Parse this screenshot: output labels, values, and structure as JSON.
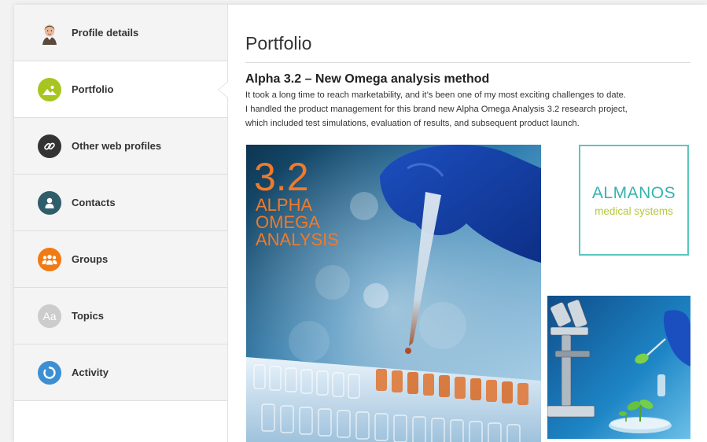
{
  "sidebar": {
    "items": [
      {
        "label": "Profile details",
        "icon": "avatar-photo"
      },
      {
        "label": "Portfolio",
        "icon": "image-icon",
        "color": "#a7c520",
        "active": true
      },
      {
        "label": "Other web profiles",
        "icon": "link-icon",
        "color": "#333333"
      },
      {
        "label": "Contacts",
        "icon": "person-icon",
        "color": "#2f5e6a"
      },
      {
        "label": "Groups",
        "icon": "group-icon",
        "color": "#f07a14"
      },
      {
        "label": "Topics",
        "icon": "topics-icon",
        "glyph": "Aa",
        "color": "#cccccc"
      },
      {
        "label": "Activity",
        "icon": "activity-icon",
        "color": "#3d8fd4"
      }
    ]
  },
  "main": {
    "page_title": "Portfolio",
    "item_title": "Alpha 3.2 – New Omega analysis method",
    "item_description_lines": [
      "It took a long time to reach marketability, and it’s been one of my most exciting challenges to date.",
      "I handled the product management for this brand new Alpha Omega Analysis 3.2 research project,",
      "which included test simulations, evaluation of results, and subsequent product launch."
    ],
    "poster": {
      "version": "3.2",
      "lines": [
        "ALPHA",
        "OMEGA",
        "ANALYSIS"
      ]
    },
    "logo": {
      "name": "ALMANOS",
      "subtitle": "medical systems",
      "border_color": "#5bc6c1",
      "name_color": "#36b3b0",
      "subtitle_color": "#b7c93a"
    }
  }
}
